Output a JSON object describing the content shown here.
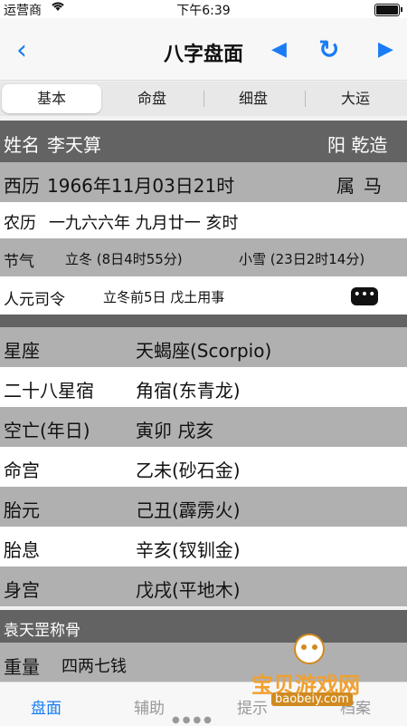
{
  "status_bar": {
    "carrier": "运营商",
    "time": "下午6:39"
  },
  "nav": {
    "title": "八字盘面",
    "back_icon": "chevron-left-icon",
    "prev_icon": "triangle-left-icon",
    "refresh_icon": "refresh-icon",
    "next_icon": "triangle-right-icon"
  },
  "tabs": [
    "基本",
    "命盘",
    "细盘",
    "大运"
  ],
  "header": {
    "name_label": "姓名",
    "name": "李天算",
    "gender": "阳 乾造"
  },
  "solar": {
    "label": "西历",
    "value": "1966年11月03日21时",
    "zodiac_label": "属",
    "zodiac": "马"
  },
  "lunar": {
    "label": "农历",
    "value": "一九六六年 九月廿一 亥时"
  },
  "solar_term": {
    "label": "节气",
    "term1": "立冬 (8日4时55分)",
    "term2": "小雪 (23日2时14分)"
  },
  "renyuan": {
    "label": "人元司令",
    "value": "立冬前5日 戊土用事"
  },
  "details": [
    {
      "label": "星座",
      "value": "天蝎座(Scorpio)"
    },
    {
      "label": "二十八星宿",
      "value": "角宿(东青龙)"
    },
    {
      "label": "空亡(年日)",
      "value": "寅卯 戌亥"
    },
    {
      "label": "命宫",
      "value": "乙未(砂石金)"
    },
    {
      "label": "胎元",
      "value": "己丑(霹雳火)"
    },
    {
      "label": "胎息",
      "value": "辛亥(钗钏金)"
    },
    {
      "label": "身宫",
      "value": "戊戌(平地木)"
    }
  ],
  "yuan_section": {
    "title": "袁天罡称骨",
    "label": "重量",
    "value": "四两七钱"
  },
  "bottom_tabs": [
    "盘面",
    "辅助",
    "提示",
    "档案"
  ],
  "watermark": {
    "text": "宝贝游戏网",
    "url": "baobeiy.com"
  },
  "colors": {
    "accent": "#1a7cf5",
    "dark_row": "#636363",
    "gray_row": "#b0b0b0"
  }
}
